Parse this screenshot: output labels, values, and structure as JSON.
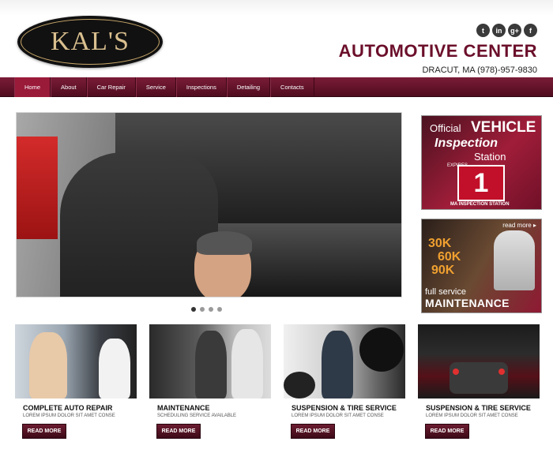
{
  "header": {
    "logo_text": "KAL'S",
    "title": "AUTOMOTIVE CENTER",
    "contact": "DRACUT, MA (978)-957-9830",
    "social": [
      {
        "name": "twitter-icon",
        "glyph": "t"
      },
      {
        "name": "linkedin-icon",
        "glyph": "in"
      },
      {
        "name": "google-plus-icon",
        "glyph": "g+"
      },
      {
        "name": "facebook-icon",
        "glyph": "f"
      }
    ]
  },
  "nav": {
    "items": [
      "Home",
      "About",
      "Car Repair",
      "Service",
      "Inspections",
      "Detailing",
      "Contacts"
    ],
    "active_index": 0
  },
  "slider": {
    "dots_count": 4,
    "active_dot": 0
  },
  "inspection_banner": {
    "official": "Official",
    "vehicle": "VEHICLE",
    "inspection": "Inspection",
    "station": "Station",
    "sticker_number": "1",
    "expires": "EXPIRES",
    "ma_station": "MA INSPECTION STATION"
  },
  "maintenance_banner": {
    "read_more": "read more ▸",
    "mileage": [
      "30K",
      "60K",
      "90K"
    ],
    "full_service": "full service",
    "maintenance": "MAINTENANCE"
  },
  "cards": [
    {
      "title": "COMPLETE AUTO REPAIR",
      "subtitle": "LOREM IPSUM DOLOR SIT AMET CONSE",
      "button": "READ MORE"
    },
    {
      "title": "MAINTENANCE",
      "subtitle": "SCHEDULING SERVICE AVAILABLE",
      "button": "READ MORE"
    },
    {
      "title": "SUSPENSION & TIRE SERVICE",
      "subtitle": "LOREM IPSUM DOLOR SIT AMET CONSE",
      "button": "READ MORE"
    },
    {
      "title": "SUSPENSION & TIRE SERVICE",
      "subtitle": "LOREM IPSUM DOLOR SIT AMET CONSE",
      "button": "READ MORE"
    }
  ],
  "colors": {
    "brand": "#6b0f2b",
    "nav_bg": "#5e1229",
    "button_bg": "#4d1020"
  }
}
